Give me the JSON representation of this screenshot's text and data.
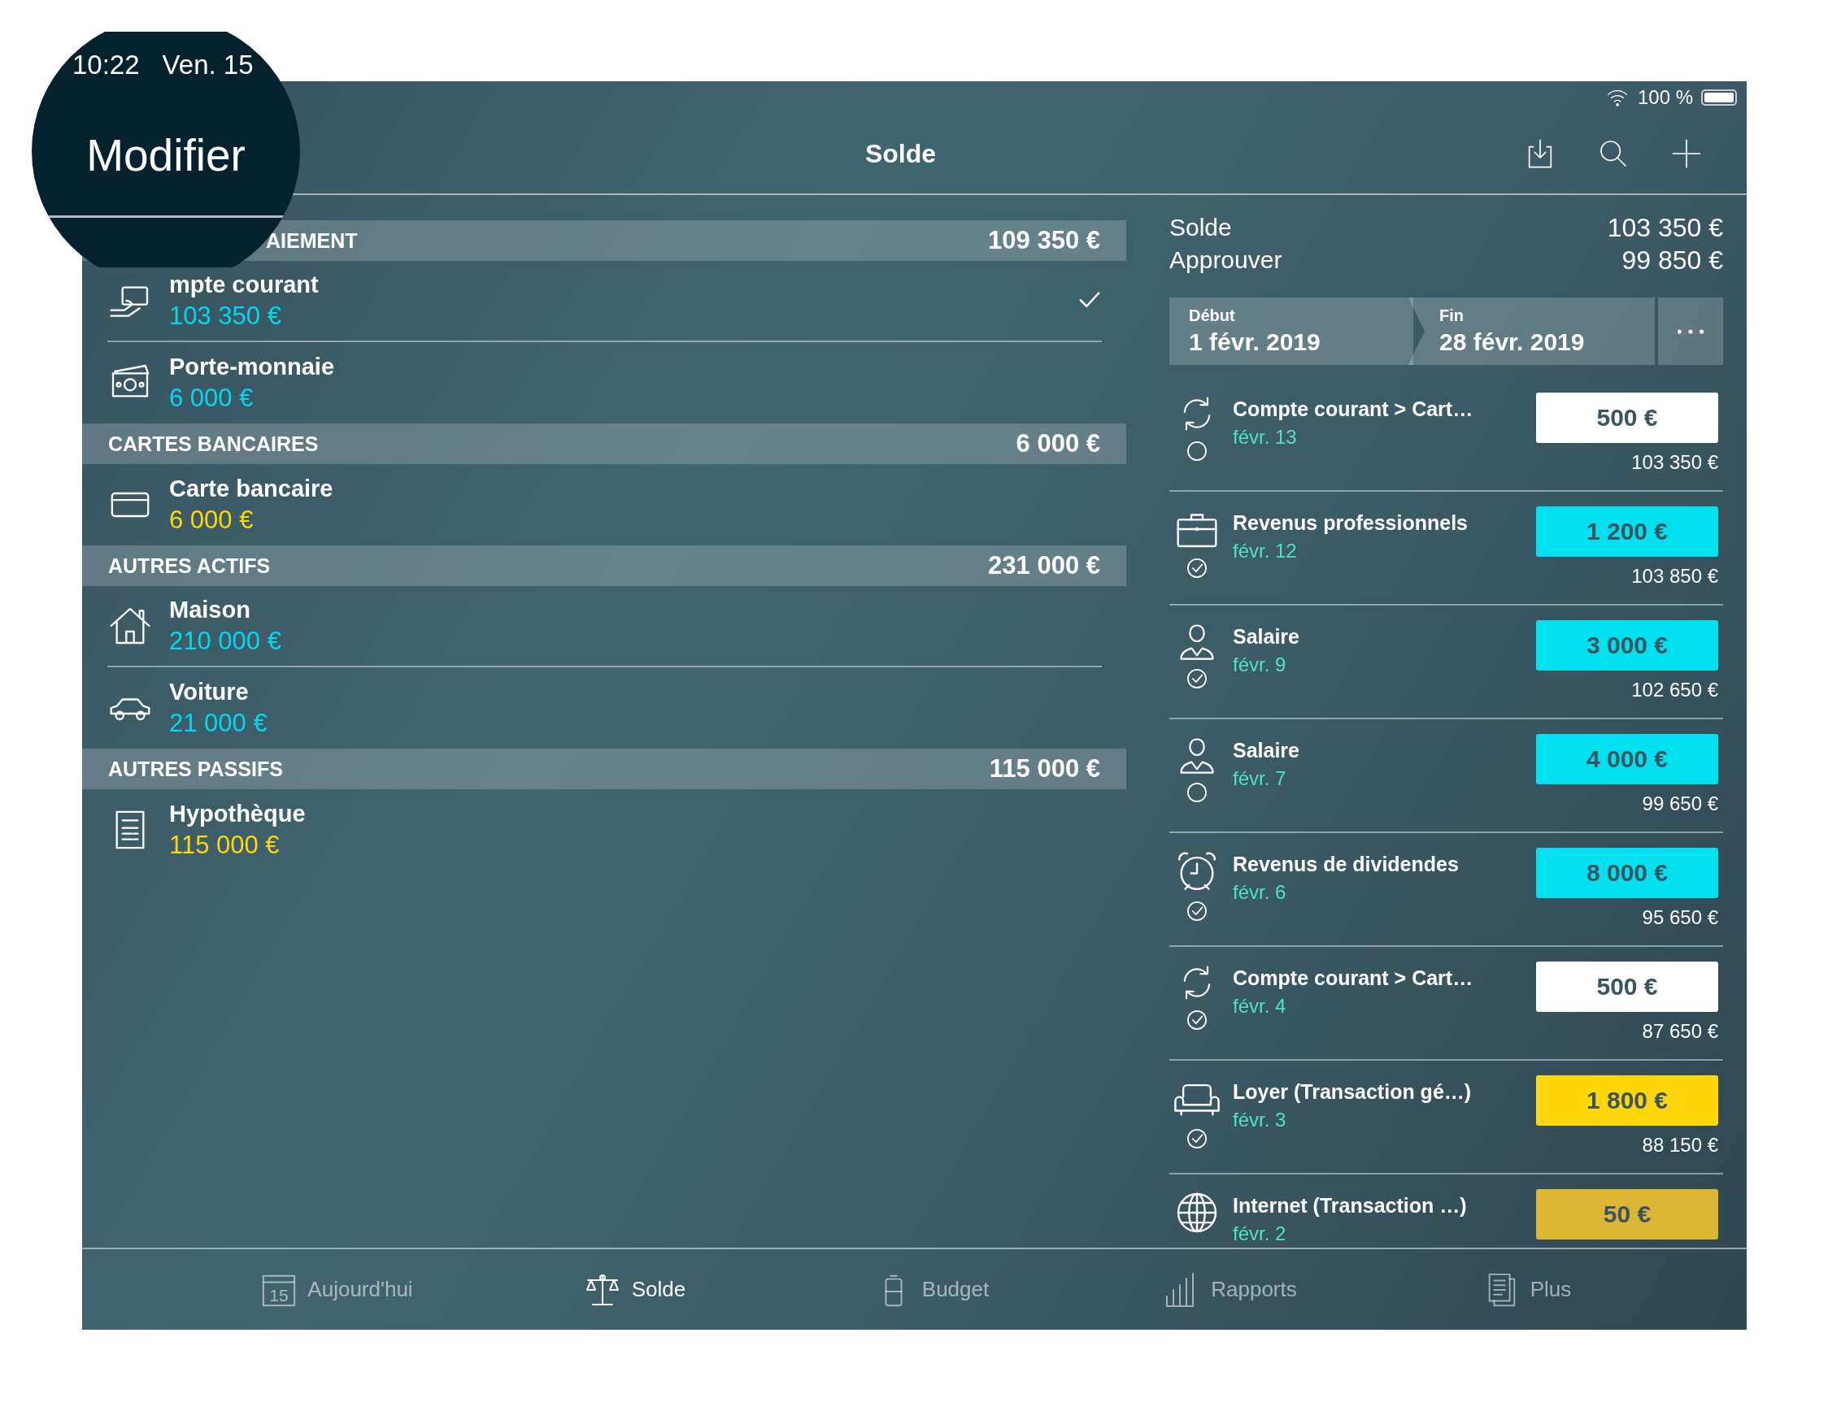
{
  "magnifier": {
    "time": "10:22",
    "date": "Ven. 15",
    "button": "Modifier"
  },
  "status_bar": {
    "battery": "100 %"
  },
  "nav": {
    "title": "Solde"
  },
  "sections": [
    {
      "title": "AIEMENT",
      "covered_left": true,
      "total": "109 350 €",
      "items": [
        {
          "kind": "card-hand",
          "name": "mpte courant",
          "amount": "103 350 €",
          "color": "#00d9f2",
          "selected": true
        },
        {
          "kind": "banknotes",
          "name": "Porte-monnaie",
          "amount": "6 000 €",
          "color": "#00d9f2",
          "selected": false
        }
      ]
    },
    {
      "title": "CARTES BANCAIRES",
      "covered_left": false,
      "total": "6 000 €",
      "items": [
        {
          "kind": "card",
          "name": "Carte bancaire",
          "amount": "6 000 €",
          "color": "#ffd60a",
          "selected": false
        }
      ]
    },
    {
      "title": "AUTRES ACTIFS",
      "covered_left": false,
      "total": "231 000 €",
      "items": [
        {
          "kind": "house",
          "name": "Maison",
          "amount": "210 000 €",
          "color": "#00d9f2",
          "selected": false
        },
        {
          "kind": "car",
          "name": "Voiture",
          "amount": "21 000 €",
          "color": "#00d9f2",
          "selected": false
        }
      ]
    },
    {
      "title": "AUTRES PASSIFS",
      "covered_left": false,
      "total": "115 000 €",
      "items": [
        {
          "kind": "document",
          "name": "Hypothèque",
          "amount": "115 000 €",
          "color": "#ffd60a",
          "selected": false
        }
      ]
    }
  ],
  "summary": [
    {
      "label": "Solde",
      "value": "103 350 €"
    },
    {
      "label": "Approuver",
      "value": "99 850 €"
    }
  ],
  "period": {
    "start_label": "Début",
    "start": "1 févr. 2019",
    "end_label": "Fin",
    "end": "28 févr. 2019"
  },
  "transactions": [
    {
      "kind": "transfer",
      "name": "Compte courant > Cart…",
      "date": "févr. 13",
      "amount": "500 €",
      "color": "#ffffff",
      "balance": "103 350 €",
      "cleared": false
    },
    {
      "kind": "briefcase",
      "name": "Revenus professionnels",
      "date": "févr. 12",
      "amount": "1 200 €",
      "color": "#00e0ef",
      "balance": "103 850 €",
      "cleared": true
    },
    {
      "kind": "person",
      "name": "Salaire",
      "date": "févr. 9",
      "amount": "3 000 €",
      "color": "#00e0ef",
      "balance": "102 650 €",
      "cleared": true
    },
    {
      "kind": "person",
      "name": "Salaire",
      "date": "févr. 7",
      "amount": "4 000 €",
      "color": "#00e0ef",
      "balance": "99 650 €",
      "cleared": false
    },
    {
      "kind": "alarm",
      "name": "Revenus de dividendes",
      "date": "févr. 6",
      "amount": "8 000 €",
      "color": "#00e0ef",
      "balance": "95 650 €",
      "cleared": true
    },
    {
      "kind": "transfer",
      "name": "Compte courant > Cart…",
      "date": "févr. 4",
      "amount": "500 €",
      "color": "#ffffff",
      "balance": "87 650 €",
      "cleared": true
    },
    {
      "kind": "sofa",
      "name": "Loyer (Transaction gé…)",
      "date": "févr. 3",
      "amount": "1 800 €",
      "color": "#ffd60a",
      "balance": "88 150 €",
      "cleared": true
    },
    {
      "kind": "globe",
      "name": "Internet (Transaction …)",
      "date": "févr. 2",
      "amount": "50 €",
      "color": "#dcb632"
    }
  ],
  "tabs": [
    {
      "kind": "calendar",
      "icon_text": "15",
      "label": "Aujourd'hui",
      "selected": false
    },
    {
      "kind": "scales",
      "label": "Solde",
      "selected": true
    },
    {
      "kind": "battery",
      "label": "Budget",
      "selected": false
    },
    {
      "kind": "bars",
      "label": "Rapports",
      "selected": false
    },
    {
      "kind": "docs",
      "label": "Plus",
      "selected": false
    }
  ]
}
